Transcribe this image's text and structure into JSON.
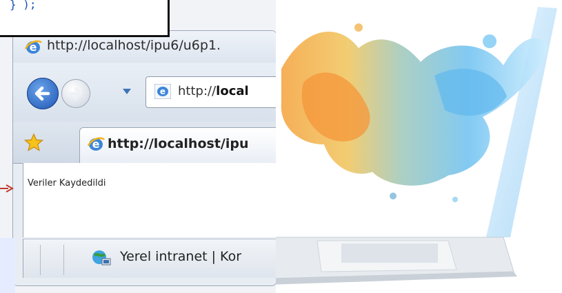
{
  "code_snippet": {
    "text": "} );"
  },
  "browser": {
    "title": "http://localhost/ipu6/u6p1.",
    "address": {
      "prefix": "http://",
      "bold": "local"
    },
    "tab": {
      "label": "http://localhost/ipu"
    },
    "content": {
      "message": "Veriler Kaydedildi"
    },
    "status": {
      "zone": "Yerel intranet | Kor"
    }
  },
  "icons": [
    "ie-icon",
    "back-arrow-icon",
    "forward-arrow-icon",
    "dropdown-icon",
    "star-icon",
    "intranet-globe-icon",
    "red-arrow-icon"
  ],
  "colors": {
    "code_text": "#1c4fb8",
    "chrome_bg": "#dfe6ef",
    "arrow": "#c0392b"
  }
}
